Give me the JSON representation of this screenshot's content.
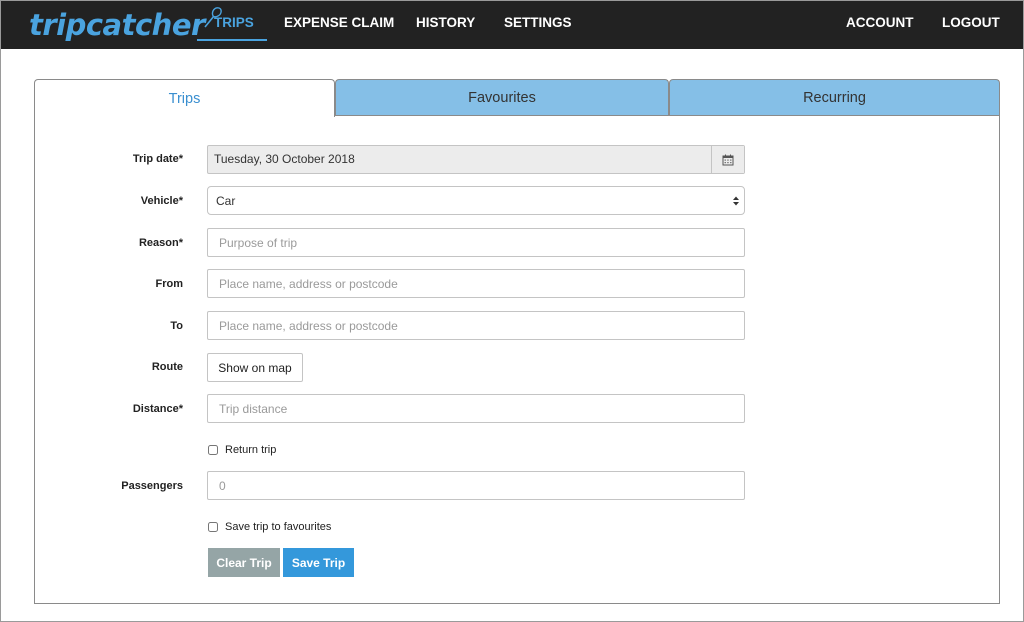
{
  "brand": {
    "name": "tripcatcher"
  },
  "nav": {
    "items": [
      {
        "label": "TRIPS",
        "active": true
      },
      {
        "label": "EXPENSE CLAIM"
      },
      {
        "label": "HISTORY"
      },
      {
        "label": "SETTINGS"
      }
    ],
    "right": [
      {
        "label": "ACCOUNT"
      },
      {
        "label": "LOGOUT"
      }
    ]
  },
  "tabs": [
    {
      "label": "Trips",
      "active": true
    },
    {
      "label": "Favourites"
    },
    {
      "label": "Recurring"
    }
  ],
  "form": {
    "trip_date": {
      "label": "Trip date*",
      "value": "Tuesday, 30 October 2018",
      "icon": "calendar-icon"
    },
    "vehicle": {
      "label": "Vehicle*",
      "value": "Car"
    },
    "reason": {
      "label": "Reason*",
      "placeholder": "Purpose of trip"
    },
    "from": {
      "label": "From",
      "placeholder": "Place name, address or postcode"
    },
    "to": {
      "label": "To",
      "placeholder": "Place name, address or postcode"
    },
    "route": {
      "label": "Route",
      "button": "Show on map"
    },
    "distance": {
      "label": "Distance*",
      "placeholder": "Trip distance"
    },
    "return_trip": {
      "label": "Return trip",
      "checked": false
    },
    "passengers": {
      "label": "Passengers",
      "placeholder": "0"
    },
    "save_favourite": {
      "label": "Save trip to favourites",
      "checked": false
    }
  },
  "actions": {
    "clear": "Clear Trip",
    "save": "Save Trip"
  },
  "colors": {
    "navbar": "#222222",
    "accent": "#4aa3df",
    "tab_inactive": "#85bfe7",
    "btn_clear": "#95a5a6",
    "btn_save": "#3498db"
  }
}
